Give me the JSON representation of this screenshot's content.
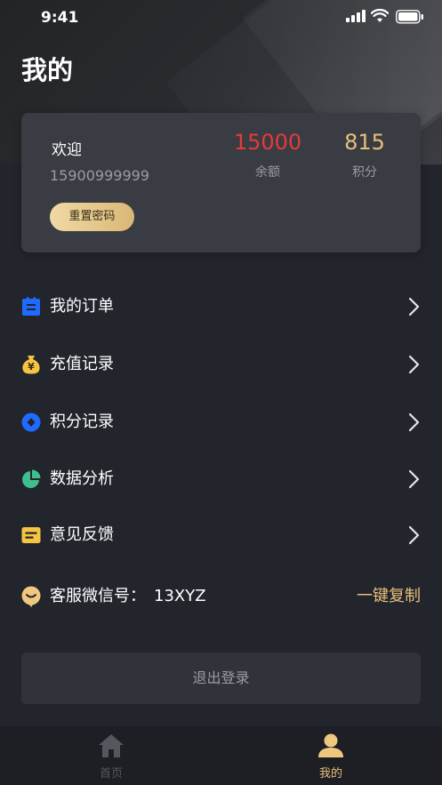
{
  "status_bar": {
    "time": "9:41"
  },
  "header": {
    "title": "我的"
  },
  "profile": {
    "welcome": "欢迎",
    "phone": "15900999999",
    "reset_password_label": "重置密码",
    "balance": {
      "value": "15000",
      "label": "余额",
      "color": "#e8393a"
    },
    "points": {
      "value": "815",
      "label": "积分",
      "color": "#e6c07a"
    }
  },
  "menu": [
    {
      "label": "我的订单",
      "icon": "order-icon",
      "color": "#1f6bff"
    },
    {
      "label": "充值记录",
      "icon": "money-bag-icon",
      "color": "#f5c542"
    },
    {
      "label": "积分记录",
      "icon": "diamond-icon",
      "color": "#1f6bff"
    },
    {
      "label": "数据分析",
      "icon": "pie-chart-icon",
      "color": "#3fbf8f"
    },
    {
      "label": "意见反馈",
      "icon": "feedback-icon",
      "color": "#f5c542"
    }
  ],
  "wechat": {
    "label": "客服微信号：",
    "id": "13XYZ",
    "copy_label": "一键复制",
    "icon": "smile-icon"
  },
  "logout_label": "退出登录",
  "tabbar": {
    "home_label": "首页",
    "mine_label": "我的"
  },
  "colors": {
    "accent_gold": "#e6c07a",
    "background": "#23252d"
  }
}
